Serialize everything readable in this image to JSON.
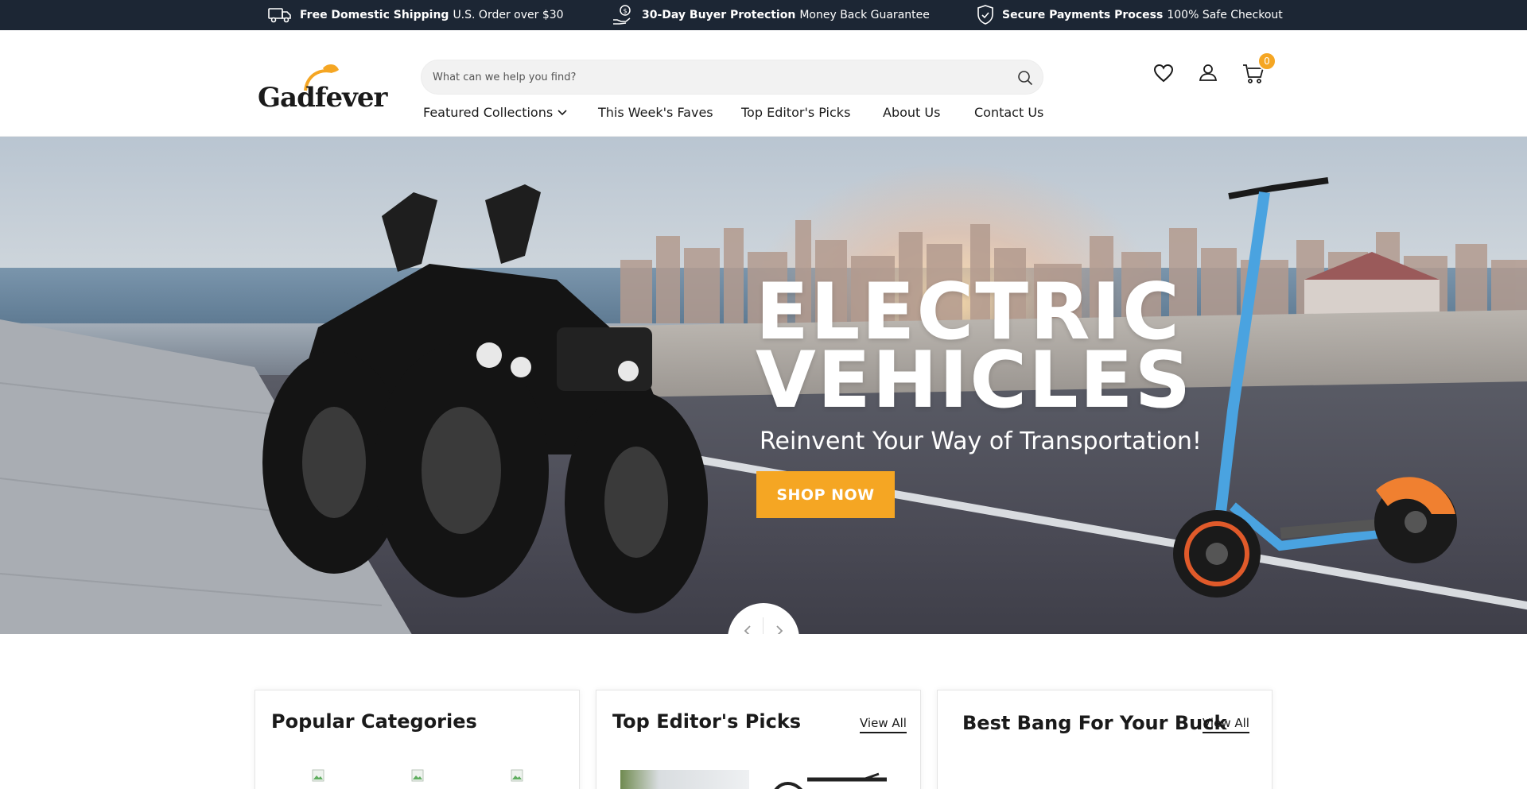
{
  "topbar": {
    "promos": [
      {
        "icon": "truck-icon",
        "bold": "Free Domestic Shipping",
        "rest": "U.S. Order over $30"
      },
      {
        "icon": "hand-coin-icon",
        "bold": "30-Day Buyer Protection",
        "rest": "Money Back Guarantee"
      },
      {
        "icon": "shield-check-icon",
        "bold": "Secure Payments Process",
        "rest": "100% Safe Checkout"
      }
    ]
  },
  "header": {
    "logo_text": "Gadfever",
    "search_placeholder": "What can we help you find?",
    "cart_count": "0",
    "nav": [
      {
        "label": "Featured Collections",
        "has_dropdown": true
      },
      {
        "label": "This Week's Faves"
      },
      {
        "label": "Top Editor's Picks"
      },
      {
        "label": "About Us"
      },
      {
        "label": "Contact Us"
      }
    ]
  },
  "hero": {
    "title_line1": "ELECTRIC",
    "title_line2": "VEHICLES",
    "subtitle": "Reinvent Your Way of Transportation!",
    "cta": "SHOP NOW"
  },
  "sections": {
    "popular": {
      "title": "Popular Categories"
    },
    "editors": {
      "title": "Top Editor's Picks",
      "link": "View All"
    },
    "bang": {
      "title": "Best Bang For Your Buck",
      "link": "View All"
    }
  },
  "colors": {
    "topbar_bg": "#1c2634",
    "accent": "#f5a623"
  }
}
